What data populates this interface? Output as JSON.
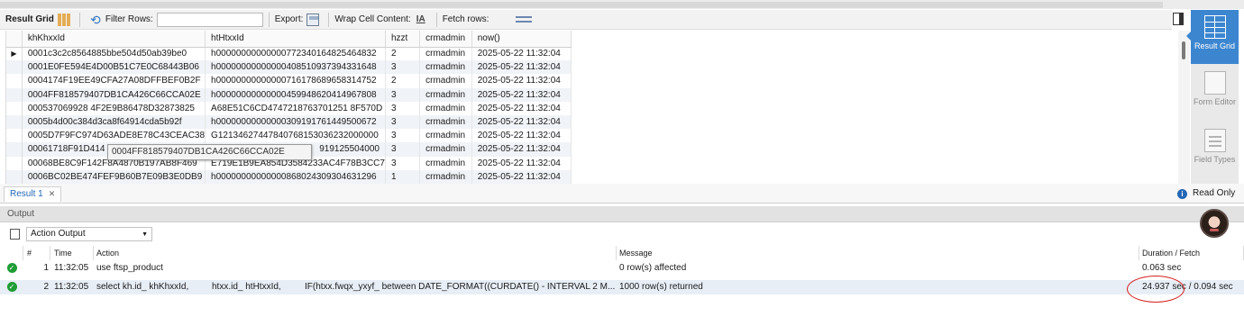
{
  "toolbar": {
    "result_grid": "Result Grid",
    "filter_rows": "Filter Rows:",
    "filter_value": "",
    "export": "Export:",
    "wrap_cell": "Wrap Cell Content:",
    "fetch_rows": "Fetch rows:"
  },
  "grid": {
    "columns": [
      "khKhxxId",
      "htHtxxId",
      "hzzt",
      "crmadmin",
      "now()"
    ],
    "rows": [
      [
        "0001c3c2c8564885bbe504d50ab39be0",
        "h00000000000000772340164825464832",
        "2",
        "crmadmin",
        "2025-05-22 11:32:04"
      ],
      [
        "0001E0FE594E4D00B51C7E0C68443B06",
        "h00000000000000408510937394331648",
        "3",
        "crmadmin",
        "2025-05-22 11:32:04"
      ],
      [
        "0004174F19EE49CFA27A08DFFBEF0B2F",
        "h00000000000000716178689658314752",
        "2",
        "crmadmin",
        "2025-05-22 11:32:04"
      ],
      [
        "0004FF818579407DB1CA426C66CCA02E",
        "h00000000000000459948620414967808",
        "3",
        "crmadmin",
        "2025-05-22 11:32:04"
      ],
      [
        "000537069928 4F2E9B86478D32873825",
        "A68E51C6CD4747218763701251 8F570D",
        "3",
        "crmadmin",
        "2025-05-22 11:32:04"
      ],
      [
        "0005b4d00c384d3ca8f64914cda5b92f",
        "h00000000000000309191761449500672",
        "3",
        "crmadmin",
        "2025-05-22 11:32:04"
      ],
      [
        "0005D7F9FC974D63ADE8E78C43CEAC38",
        "G12134627447840768153036232000000",
        "3",
        "crmadmin",
        "2025-05-22 11:32:04"
      ],
      [
        "00061718F91D414",
        "919125504000",
        "3",
        "crmadmin",
        "2025-05-22 11:32:04"
      ],
      [
        "00068BE8C9F142F8A4870B197AB8F469",
        "E719E1B9EA854D3584233AC4F78B3CC7",
        "3",
        "crmadmin",
        "2025-05-22 11:32:04"
      ],
      [
        "0006BC02BE474FEF9B60B7E09B3E0DB9",
        "h00000000000000868024309304631296",
        "1",
        "crmadmin",
        "2025-05-22 11:32:04"
      ]
    ],
    "tooltip": "0004FF818579407DB1CA426C66CCA02E"
  },
  "sidebar": {
    "result_grid": "Result Grid",
    "form_editor": "Form Editor",
    "field_types": "Field Types"
  },
  "result_tab": {
    "label": "Result 1",
    "close": "✕"
  },
  "read_only": "Read Only",
  "output": {
    "title": "Output",
    "action_select": "Action Output",
    "headers": {
      "num": "#",
      "time": "Time",
      "action": "Action",
      "message": "Message",
      "duration": "Duration / Fetch"
    },
    "rows": [
      {
        "num": "1",
        "time": "11:32:05",
        "action": "use ftsp_product",
        "message": "0 row(s) affected",
        "duration": "0.063 sec"
      },
      {
        "num": "2",
        "time": "11:32:05",
        "action_parts": [
          "select kh.id_ khKhxxId,",
          "htxx.id_ htHtxxId,",
          "IF(htxx.fwqx_yxyf_ between DATE_FORMAT((CURDATE() - INTERVAL 2 M..."
        ],
        "message": "1000 row(s) returned",
        "duration": "24.937 sec / 0.094 sec"
      }
    ]
  },
  "colors": {
    "accent": "#3c86d0",
    "ok": "#1f9c35",
    "annotation": "#d62020"
  }
}
